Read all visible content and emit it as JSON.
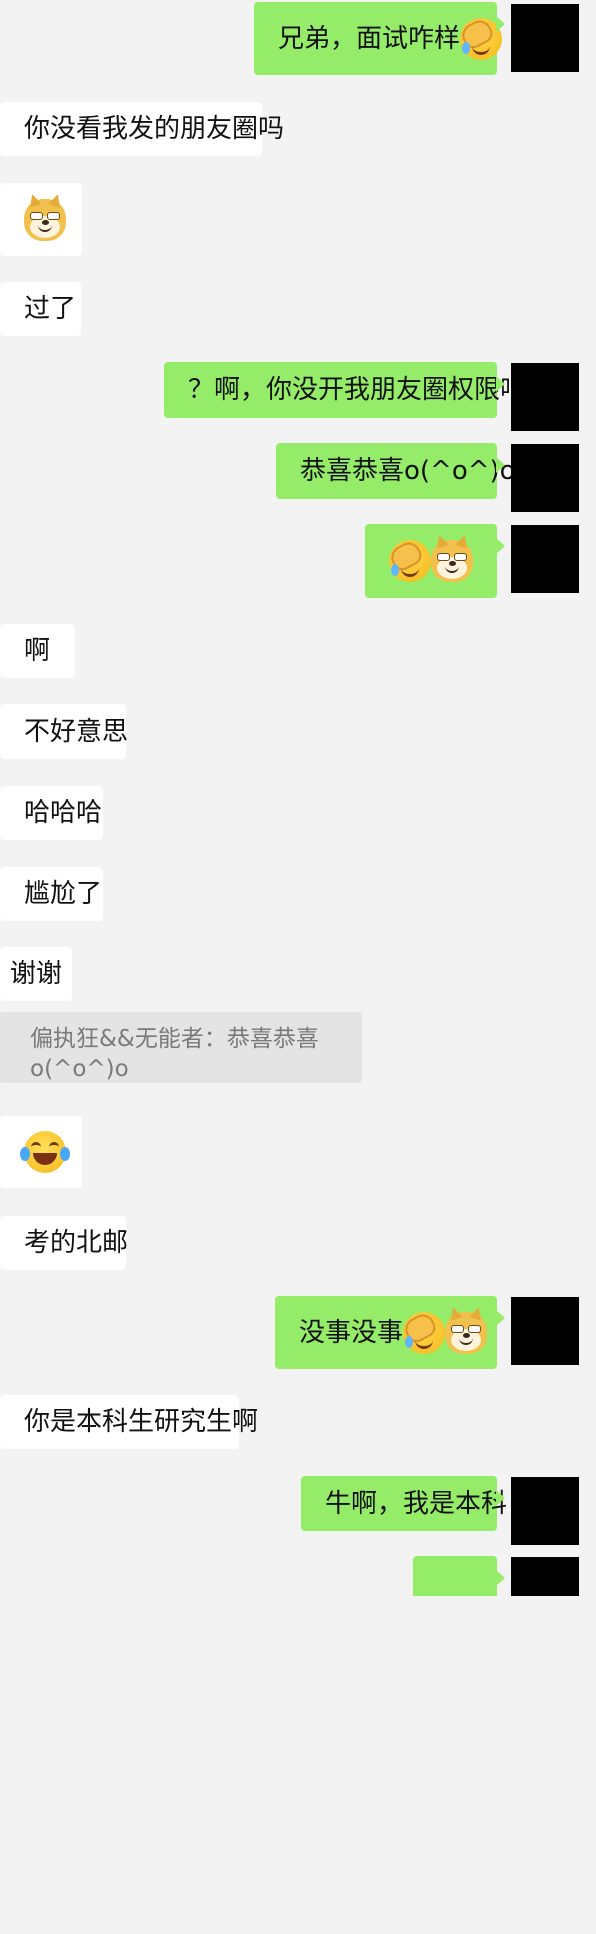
{
  "messages": [
    {
      "side": "out",
      "text": "兄弟，面试咋样",
      "emojis": [
        "facepalm"
      ]
    },
    {
      "side": "in",
      "text": "你没看我发的朋友圈吗"
    },
    {
      "side": "in",
      "text": "",
      "emojis": [
        "doge"
      ]
    },
    {
      "side": "in",
      "text": "过了"
    },
    {
      "side": "out",
      "text": "？啊，你没开我朋友圈权限吧"
    },
    {
      "side": "out",
      "text": "恭喜恭喜o(^o^)o"
    },
    {
      "side": "out",
      "text": "",
      "emojis": [
        "facepalm",
        "doge"
      ]
    },
    {
      "side": "in",
      "text": "啊"
    },
    {
      "side": "in",
      "text": "不好意思"
    },
    {
      "side": "in",
      "text": "哈哈哈"
    },
    {
      "side": "in",
      "text": "尴尬了"
    },
    {
      "side": "in",
      "text": "谢谢"
    },
    {
      "side": "in",
      "text": "",
      "emojis": [
        "tears-of-joy"
      ]
    },
    {
      "side": "in",
      "text": "考的北邮"
    },
    {
      "side": "out",
      "text": "没事没事",
      "emojis": [
        "facepalm",
        "doge"
      ]
    },
    {
      "side": "in",
      "text": "你是本科生研究生啊"
    },
    {
      "side": "out",
      "text": "牛啊，我是本科"
    }
  ],
  "quote": {
    "author": "偏执狂&&无能者",
    "separator": "：",
    "text": "恭喜恭喜o(^o^)o"
  },
  "colors": {
    "background": "#f3f3f3",
    "outgoing_bubble": "#95ec69",
    "incoming_bubble": "#ffffff",
    "quote_bubble": "#e4e4e4",
    "avatar": "#000000"
  }
}
